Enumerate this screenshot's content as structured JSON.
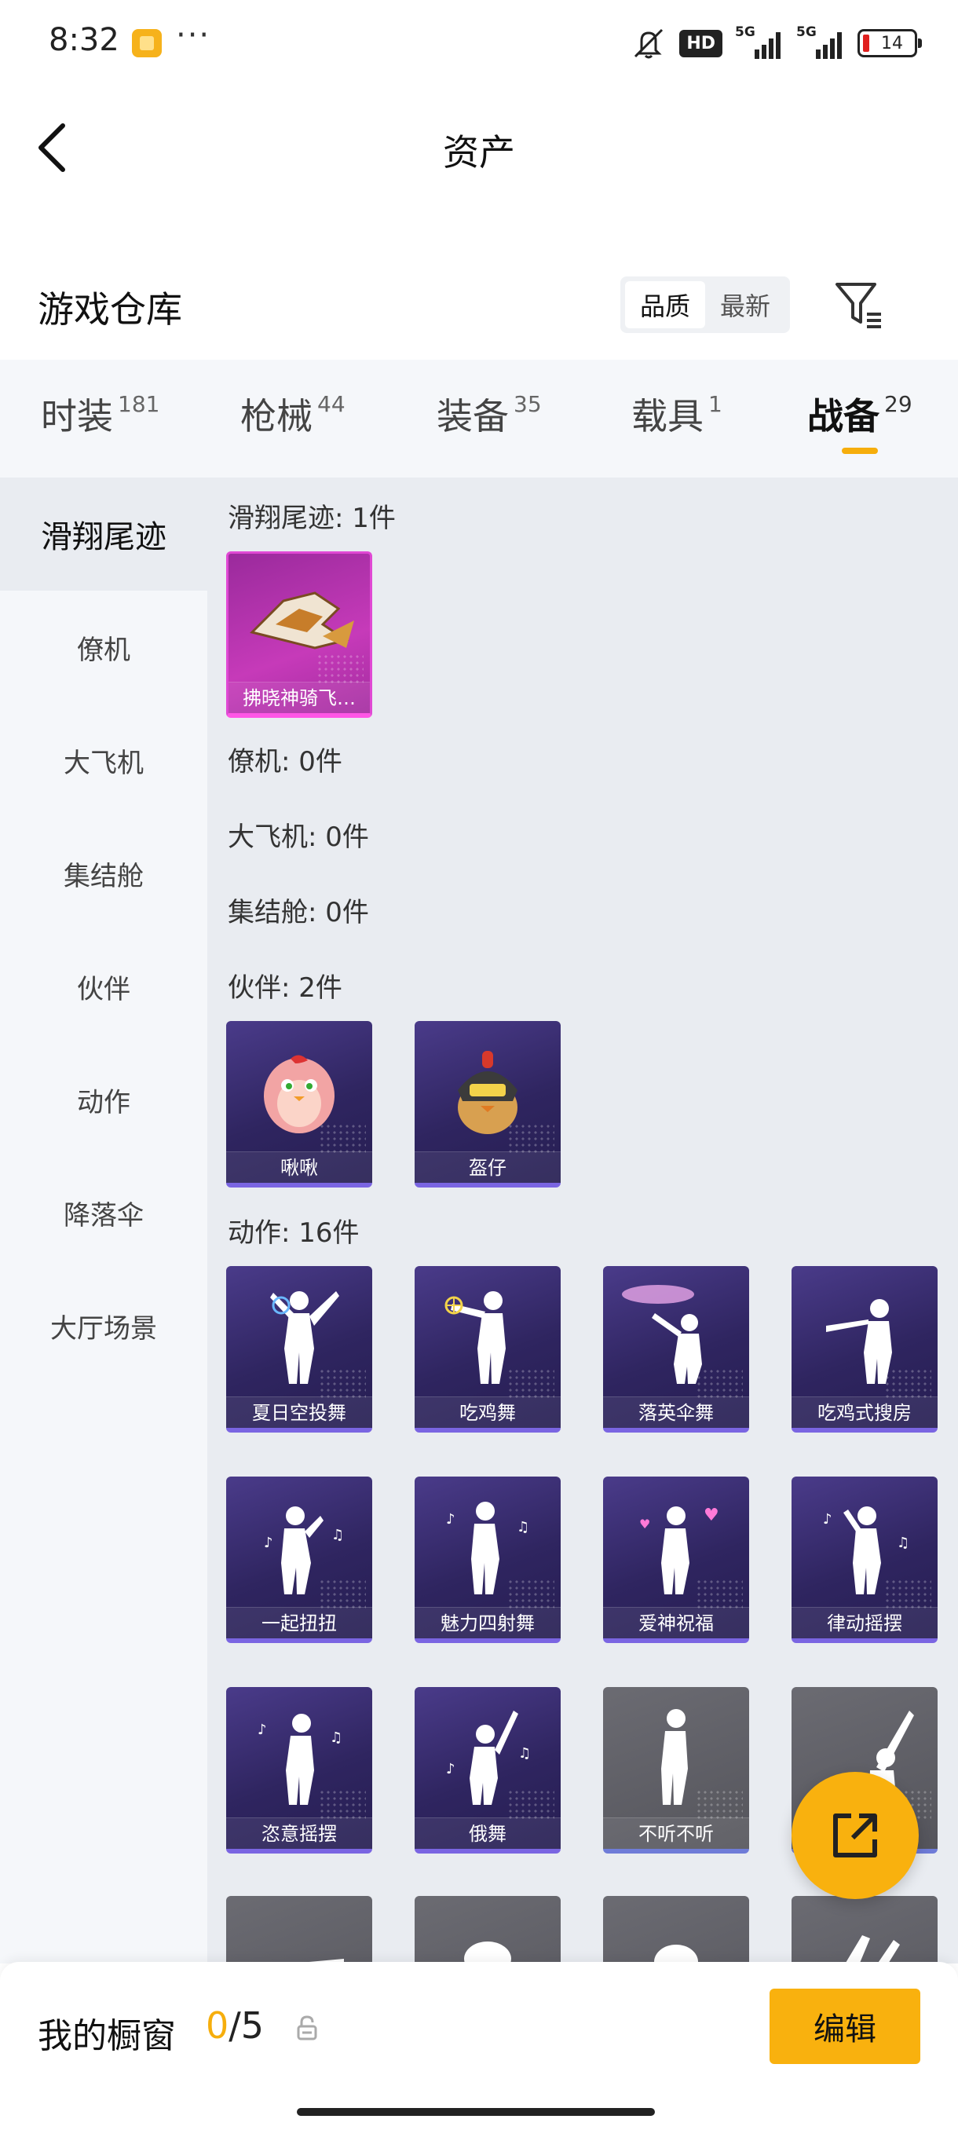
{
  "status_bar": {
    "time": "8:32",
    "dots": "···",
    "hd_badge": "HD",
    "signal_1": "5G",
    "signal_2": "5G",
    "battery": "14"
  },
  "nav": {
    "title": "资产"
  },
  "section": {
    "title": "游戏仓库",
    "sort_options": [
      "品质",
      "最新"
    ],
    "sort_active": "品质"
  },
  "tabs": [
    {
      "label": "时装",
      "count": "181"
    },
    {
      "label": "枪械",
      "count": "44"
    },
    {
      "label": "装备",
      "count": "35"
    },
    {
      "label": "载具",
      "count": "1"
    },
    {
      "label": "战备",
      "count": "29",
      "active": true
    }
  ],
  "sidebar": {
    "items": [
      "滑翔尾迹",
      "僚机",
      "大飞机",
      "集结舱",
      "伙伴",
      "动作",
      "降落伞",
      "大厅场景"
    ],
    "active": "滑翔尾迹"
  },
  "groups": {
    "glide": {
      "label": "滑翔尾迹: 1件",
      "items": [
        "拂晓神骑飞…"
      ]
    },
    "wingman": {
      "label": "僚机: 0件"
    },
    "bigplane": {
      "label": "大飞机: 0件"
    },
    "pod": {
      "label": "集结舱: 0件"
    },
    "partner": {
      "label": "伙伴: 2件",
      "items": [
        "啾啾",
        "盔仔"
      ]
    },
    "emote": {
      "label": "动作: 16件",
      "items": [
        "夏日空投舞",
        "吃鸡舞",
        "落英伞舞",
        "吃鸡式搜房",
        "一起扭扭",
        "魅力四射舞",
        "爱神祝福",
        "律动摇摆",
        "恣意摇摆",
        "俄舞",
        "不听不听",
        "",
        "",
        "",
        "",
        ""
      ]
    }
  },
  "bottom": {
    "label": "我的橱窗",
    "current": "0",
    "total": "/5",
    "edit": "编辑"
  },
  "colors": {
    "accent": "#f9b10e",
    "card_purple": "#2f2560",
    "card_magenta": "#c63ab9",
    "card_gray": "#5c5c63"
  },
  "icons": [
    "back-arrow-icon",
    "filter-icon",
    "share-icon",
    "lock-icon",
    "mute-icon"
  ]
}
